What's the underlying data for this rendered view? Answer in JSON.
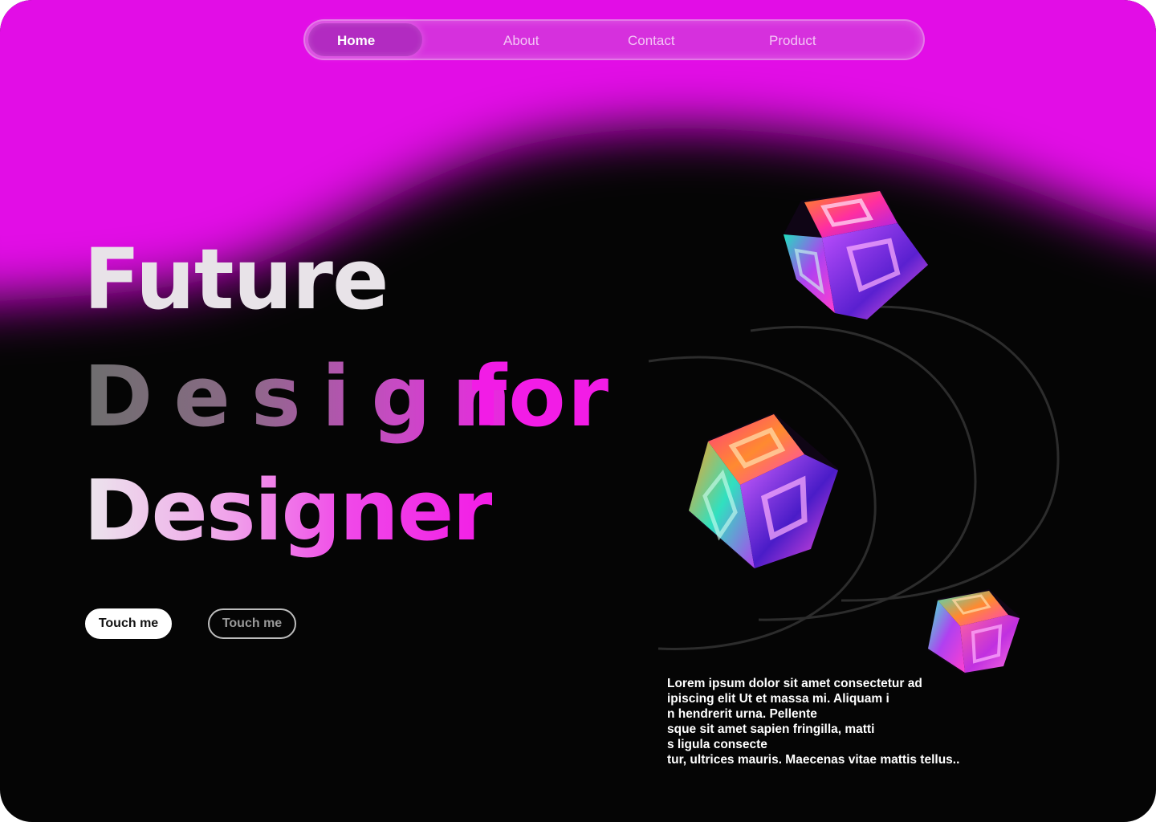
{
  "nav": {
    "items": [
      {
        "label": "Home",
        "active": true
      },
      {
        "label": "About",
        "active": false
      },
      {
        "label": "Contact",
        "active": false
      },
      {
        "label": "Product",
        "active": false
      }
    ]
  },
  "hero": {
    "line1": "Future",
    "line2_word1": "Design",
    "line2_word2": "for",
    "line3": "Designer"
  },
  "buttons": {
    "primary_label": "Touch me",
    "secondary_label": "Touch me"
  },
  "body_text": {
    "lines": [
      "Lorem ipsum dolor sit amet consectetur ad",
      "ipiscing elit Ut et massa mi. Aliquam i",
      "n hendrerit urna. Pellente",
      "sque sit amet sapien fringilla, matti",
      "s ligula consecte",
      "tur, ultrices mauris. Maecenas vitae mattis tellus.."
    ]
  },
  "colors": {
    "background": "#050505",
    "accent_magenta": "#e20ae6",
    "heading_white": "#e8e3e8",
    "arc_stroke": "#2e2e2e"
  },
  "icons": [
    "glass-cube-icon",
    "glass-cube-icon",
    "glass-cube-icon"
  ]
}
